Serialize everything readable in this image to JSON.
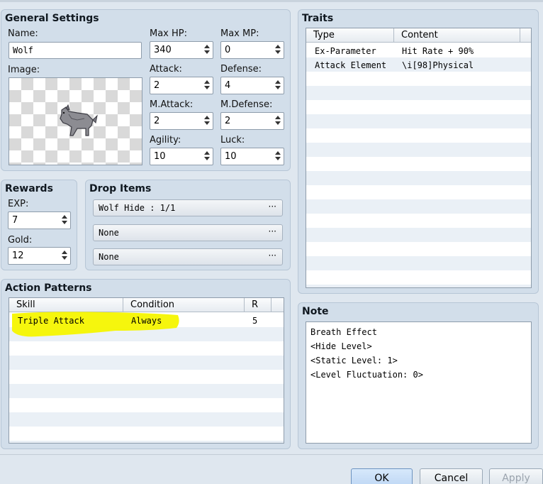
{
  "general": {
    "title": "General Settings",
    "name_label": "Name:",
    "name_value": "Wolf",
    "image_label": "Image:",
    "maxhp_label": "Max HP:",
    "maxhp_value": "340",
    "maxmp_label": "Max MP:",
    "maxmp_value": "0",
    "attack_label": "Attack:",
    "attack_value": "2",
    "defense_label": "Defense:",
    "defense_value": "4",
    "matk_label": "M.Attack:",
    "matk_value": "2",
    "mdef_label": "M.Defense:",
    "mdef_value": "2",
    "agility_label": "Agility:",
    "agility_value": "10",
    "luck_label": "Luck:",
    "luck_value": "10"
  },
  "rewards": {
    "title": "Rewards",
    "exp_label": "EXP:",
    "exp_value": "7",
    "gold_label": "Gold:",
    "gold_value": "12"
  },
  "drops": {
    "title": "Drop Items",
    "items": [
      "Wolf Hide : 1/1",
      "None",
      "None"
    ],
    "dots": "···"
  },
  "actions": {
    "title": "Action Patterns",
    "headers": {
      "skill": "Skill",
      "condition": "Condition",
      "r": "R"
    },
    "rows": [
      {
        "skill": "Triple Attack",
        "condition": "Always",
        "r": "5"
      }
    ]
  },
  "traits": {
    "title": "Traits",
    "headers": {
      "type": "Type",
      "content": "Content"
    },
    "rows": [
      {
        "type": "Ex-Parameter",
        "content": "Hit Rate + 90%"
      },
      {
        "type": "Attack Element",
        "content": "\\i[98]Physical"
      }
    ]
  },
  "note": {
    "title": "Note",
    "lines": [
      "Breath Effect",
      "<Hide Level>",
      "<Static Level: 1>",
      "<Level Fluctuation: 0>"
    ]
  },
  "buttons": {
    "ok": "OK",
    "cancel": "Cancel",
    "apply": "Apply"
  },
  "colors": {
    "highlight": "#f6f600",
    "panel": "#d2deea",
    "row_alt": "#eaf0f6"
  }
}
